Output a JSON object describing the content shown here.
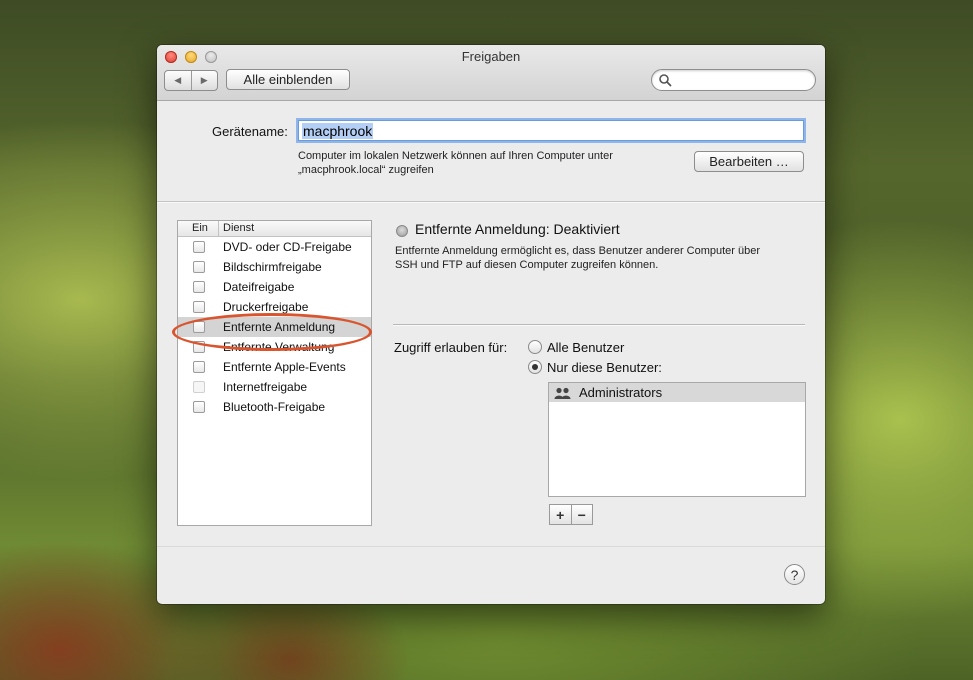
{
  "window": {
    "title": "Freigaben",
    "show_all_label": "Alle einblenden",
    "search_placeholder": ""
  },
  "device": {
    "label": "Gerätename:",
    "value": "macphrook",
    "description_line1": "Computer im lokalen Netzwerk können auf Ihren Computer unter",
    "description_line2": "„macphrook.local“ zugreifen",
    "edit_label": "Bearbeiten …"
  },
  "services": {
    "header_on": "Ein",
    "header_service": "Dienst",
    "items": [
      {
        "label": "DVD- oder CD-Freigabe",
        "enabled": false
      },
      {
        "label": "Bildschirmfreigabe",
        "enabled": false
      },
      {
        "label": "Dateifreigabe",
        "enabled": false
      },
      {
        "label": "Druckerfreigabe",
        "enabled": false
      },
      {
        "label": "Entfernte Anmeldung",
        "enabled": false,
        "selected": true
      },
      {
        "label": "Entfernte Verwaltung",
        "enabled": false
      },
      {
        "label": "Entfernte Apple-Events",
        "enabled": false
      },
      {
        "label": "Internetfreigabe",
        "enabled": false,
        "disabled": true
      },
      {
        "label": "Bluetooth-Freigabe",
        "enabled": false
      }
    ]
  },
  "detail": {
    "status": "Entfernte Anmeldung: Deaktiviert",
    "description_line1": "Entfernte Anmeldung ermöglicht es, dass Benutzer anderer Computer über",
    "description_line2": "SSH und FTP auf diesen Computer zugreifen können.",
    "access_label": "Zugriff erlauben für:",
    "radio_all": "Alle Benutzer",
    "radio_only": "Nur diese Benutzer:",
    "selected_radio": "only",
    "users": [
      "Administrators"
    ],
    "add_label": "+",
    "remove_label": "−"
  },
  "help_label": "?",
  "colors": {
    "highlight_ring": "#d9552f",
    "focus_ring": "#8fb6ea"
  }
}
